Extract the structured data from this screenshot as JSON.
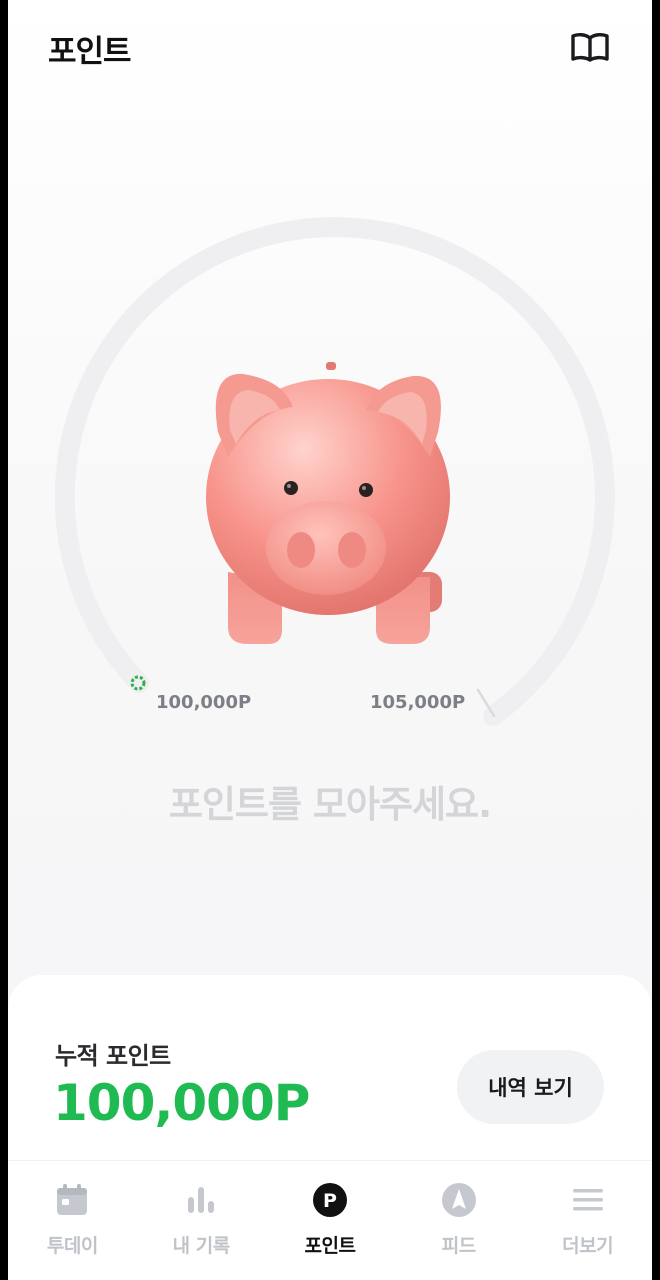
{
  "header": {
    "title": "포인트",
    "guide_icon": "open-book-icon"
  },
  "progress": {
    "start_label": "100,000P",
    "end_label": "105,000P",
    "fraction": 0.0,
    "accent": "#1fba52",
    "track_color": "#efeff2"
  },
  "prompt": "포인트를 모아주세요.",
  "summary": {
    "label": "누적 포인트",
    "value": "100,000P",
    "history_button": "내역 보기",
    "value_color": "#1fba52"
  },
  "tabbar": {
    "items": [
      {
        "label": "투데이",
        "icon": "calendar-icon",
        "active": false
      },
      {
        "label": "내 기록",
        "icon": "bar-chart-icon",
        "active": false
      },
      {
        "label": "포인트",
        "icon": "point-coin-icon",
        "active": true
      },
      {
        "label": "피드",
        "icon": "compass-icon",
        "active": false
      },
      {
        "label": "더보기",
        "icon": "menu-icon",
        "active": false
      }
    ]
  }
}
